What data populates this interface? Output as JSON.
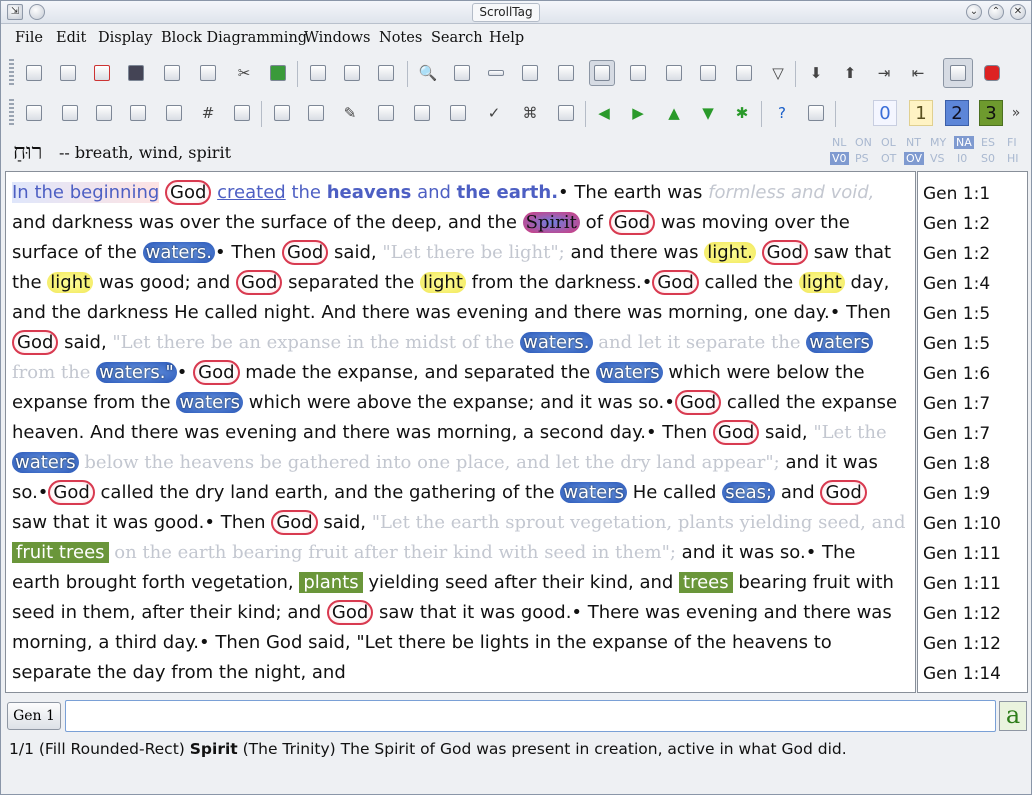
{
  "window": {
    "title": "ScrollTag"
  },
  "menu": [
    "File",
    "Edit",
    "Display",
    "Block Diagramming",
    "Windows",
    "Notes",
    "Search",
    "Help"
  ],
  "toolbar2": {
    "counter_labels": [
      "0",
      "1",
      "2",
      "3"
    ],
    "overflow": "»"
  },
  "word": {
    "hebrew": "רוּחַ",
    "gloss": "-- breath, wind, spirit"
  },
  "versions": {
    "row1": [
      "NL",
      "ON",
      "OL",
      "NT",
      "MY",
      "NA",
      "ES",
      "FI"
    ],
    "row2": [
      "V0",
      "PS",
      "OT",
      "OV",
      "VS",
      "I0",
      "S0",
      "HI"
    ],
    "selected_row1": "NA",
    "selected_row2": [
      "V0",
      "OV"
    ]
  },
  "text": {
    "l1a": "In the beginning",
    "god": "God",
    "created": "created",
    "the": " the ",
    "heavens": "heavens",
    "and": " and ",
    "theearth": "the earth.",
    "the_earth_was": "• The earth was ",
    "formless": "formless and",
    "void": "void,",
    "l2": " and darkness was over the surface of the deep, and the ",
    "spirit": "Spirit",
    "of": " of ",
    "moving": " was moving",
    "l3a": "over the surface of the ",
    "waters": "waters.",
    "then": "• Then ",
    "said": " said, ",
    "let_light": "\"Let there be light\";",
    "there_was": " and there was ",
    "light_dot": "light.",
    "saw": " saw that the ",
    "light": "light",
    "was_good": " was good; and ",
    "separated": " separated the ",
    "from_dark": " from the darkness.•",
    "called_the": "called the ",
    "day": " day, and the darkness He called night. And there was evening and there",
    "morning": "was morning, one day.• Then ",
    "said2": " said, ",
    "expanse_q": "\"Let there be an expanse in the midst of the",
    "sep_q": "and let it separate the",
    "from_the": "from the",
    "waters_q": "waters.\"",
    "made": " made the expanse, and separated the",
    "waters2": "waters",
    "below": " which were below the expanse from the ",
    "above": " which were above the expanse; and",
    "itwasso": "it was so.•",
    "called_heaven": " called the expanse heaven. And there was evening and there was morning,",
    "second": "a second day.• Then ",
    "below_heavens_q": "\"Let the",
    "below_q2": " below the heavens be gathered into one place,",
    "dry_q": "and let the dry land appear\";",
    "so2": " and it was so.•",
    "called_dry": " called the dry land earth, and the gathering",
    "of_the": "of the ",
    "he_called": " He called ",
    "seas": "seas;",
    "and_god": " and ",
    "saw_good": " saw that it was good.• Then ",
    "said3": " said, ",
    "earth_q": "\"Let the earth",
    "sprout": "sprout vegetation, plants yielding seed, and",
    "fruit_trees": "fruit trees",
    "on_earth": " on the earth bearing fruit after their",
    "kind_q": "kind with seed in them\";",
    "brought": " and it was so.• The earth brought forth vegetation, ",
    "plants": "plants",
    "yielding": " yielding",
    "seed_after": "seed after their kind, and ",
    "trees": "trees",
    "bearing": " bearing fruit with seed in them, after their kind; and ",
    "saw2": " saw",
    "good3": "that it was good.• There was evening and there was morning, a third day.• Then God said,",
    "lights": "\"Let there be lights in the expanse of the heavens to separate the day from the night, and"
  },
  "refs": [
    "Gen 1:1",
    "Gen 1:2",
    "Gen 1:2",
    "Gen 1:4",
    "Gen 1:5",
    "Gen 1:5",
    "Gen 1:6",
    "Gen 1:7",
    "Gen 1:7",
    "Gen 1:8",
    "Gen 1:9",
    "Gen 1:10",
    "Gen 1:11",
    "Gen 1:11",
    "Gen 1:12",
    "Gen 1:12",
    "Gen 1:14"
  ],
  "bottom": {
    "gen_button": "Gen 1",
    "input_value": "",
    "a_button": "a"
  },
  "status": {
    "prefix": "1/1 (Fill Rounded-Rect) ",
    "word": "Spirit",
    "rest": " (The Trinity) The Spirit of God was present in creation, active in what God did."
  }
}
